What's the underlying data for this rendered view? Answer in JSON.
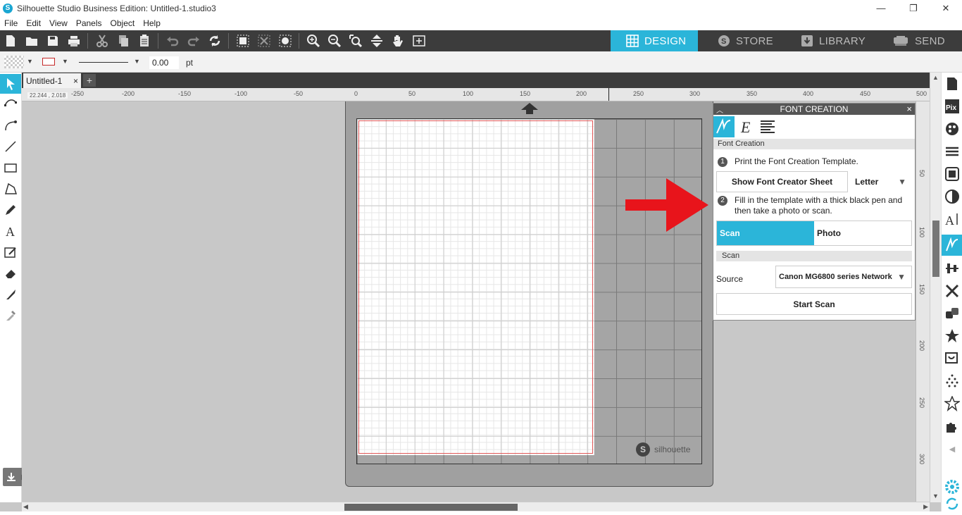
{
  "window": {
    "title": "Silhouette Studio Business Edition: Untitled-1.studio3",
    "minimize": "—",
    "restore": "❐",
    "close": "✕"
  },
  "menu": [
    "File",
    "Edit",
    "View",
    "Panels",
    "Object",
    "Help"
  ],
  "modes": [
    {
      "label": "DESIGN",
      "active": true
    },
    {
      "label": "STORE",
      "active": false
    },
    {
      "label": "LIBRARY",
      "active": false
    },
    {
      "label": "SEND",
      "active": false
    }
  ],
  "properties": {
    "line_width_value": "0.00",
    "line_width_unit": "pt"
  },
  "document": {
    "tab_name": "Untitled-1",
    "tab_close": "×",
    "add_tab": "+"
  },
  "ruler": {
    "coords": "22.244 , 2.018",
    "h_labels": [
      "-250",
      "-200",
      "-150",
      "-100",
      "-50",
      "0",
      "50",
      "100",
      "150",
      "200",
      "250",
      "300",
      "350",
      "400",
      "450",
      "500"
    ],
    "v_labels": [
      "50",
      "100",
      "150",
      "200",
      "250",
      "300"
    ]
  },
  "mat": {
    "brand": "silhouette"
  },
  "font_creation": {
    "title": "FONT CREATION",
    "close": "×",
    "section_label": "Font Creation",
    "step1_num": "1",
    "step1_text": "Print the Font Creation Template.",
    "show_sheet_button": "Show Font Creator Sheet",
    "paper_size": "Letter",
    "step2_num": "2",
    "step2_text": "Fill in the template with a thick black pen and then take a photo or scan.",
    "method_scan": "Scan",
    "method_photo": "Photo",
    "scan_section_label": "Scan",
    "source_label": "Source",
    "source_value": "Canon MG6800 series Network",
    "start_scan_button": "Start Scan"
  },
  "colors": {
    "accent": "#2bb5d9",
    "toolbar_bg": "#3c3c3c",
    "annotation_arrow": "#e8141b",
    "cut_line": "#e05656"
  }
}
